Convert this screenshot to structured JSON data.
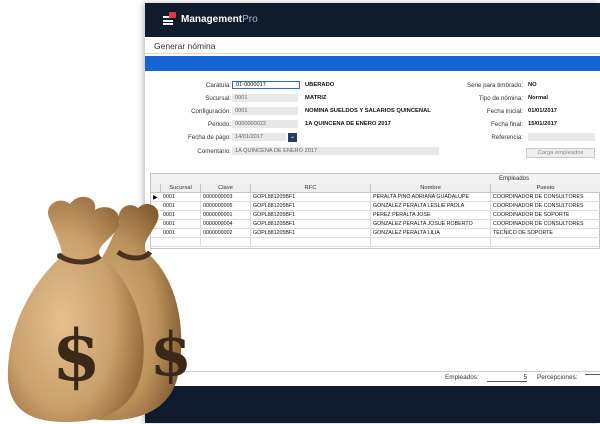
{
  "app": {
    "name": "Management",
    "name_suffix": "Pro",
    "notification_count": ""
  },
  "page": {
    "title": "Generar nómina"
  },
  "form": {
    "caratula": {
      "label": "Carátula:",
      "value": "01-0000017",
      "desc": "UBERADO"
    },
    "sucursal": {
      "label": "Sucursal:",
      "value": "0001",
      "desc": "MATRIZ"
    },
    "configuracion": {
      "label": "Configuración:",
      "value": "0001",
      "desc": "NOMINA SUELDOS Y SALARIOS QUINCENAL"
    },
    "periodo": {
      "label": "Periodo:",
      "value": "0000000022",
      "desc": "1A QUINCENA DE ENERO 2017"
    },
    "fecha_pago": {
      "label": "Fecha de pago:",
      "value": "14/01/2017"
    },
    "comentario": {
      "label": "Comentario:",
      "value": "1A QUINCENA DE ENERO 2017"
    },
    "serie_timbrado": {
      "label": "Serie para timbrado:",
      "value": "NO"
    },
    "tipo_nomina": {
      "label": "Tipo de nómina:",
      "value": "Normal"
    },
    "fecha_inicial": {
      "label": "Fecha inicial:",
      "value": "01/01/2017"
    },
    "fecha_final": {
      "label": "Fecha final:",
      "value": "15/01/2017"
    },
    "referencia": {
      "label": "Referencia:",
      "value": ""
    },
    "carga_button": "Carga empleados"
  },
  "grid": {
    "group_title": "Empleados",
    "columns": [
      "Sucursal",
      "Clave",
      "RFC",
      "Nombre",
      "Puesto"
    ],
    "rows": [
      [
        "0001",
        "0000000003",
        "GOPL881205BF1",
        "PERALTA PINO ADRIANA GUADALUPE",
        "COORDINADOR DE CONSULTORES"
      ],
      [
        "0001",
        "0000000005",
        "GOPL881205BF1",
        "GONZALEZ PERALTA LESLIE PAOLA",
        "COORDINADOR DE CONSULTORES"
      ],
      [
        "0001",
        "0000000001",
        "GOPL881205BF1",
        "PEREZ PERALTA JOSE",
        "COORDINADOR DE SOPORTE"
      ],
      [
        "0001",
        "0000000004",
        "GOPL881205BF1",
        "GONZALEZ PERALTA JOSUE ROBERTO",
        "COORDINADOR DE CONSULTORES"
      ],
      [
        "0001",
        "0000000002",
        "GOPL881205BF1",
        "GONZALEZ PERALTA LILIA",
        "TECNICO DE SOPORTE"
      ]
    ]
  },
  "footer": {
    "empleados_label": "Empleados:",
    "empleados_value": "5",
    "percepciones_label": "Percepciones:"
  },
  "icons": {
    "menu": "hamburger-menu-icon",
    "calendar": "calendar-dropdown-icon",
    "money": "money-bag-icon"
  },
  "colors": {
    "titlebar": "#0f1c2e",
    "accent_bar": "#1464d4",
    "bag": "#c9a06a"
  }
}
